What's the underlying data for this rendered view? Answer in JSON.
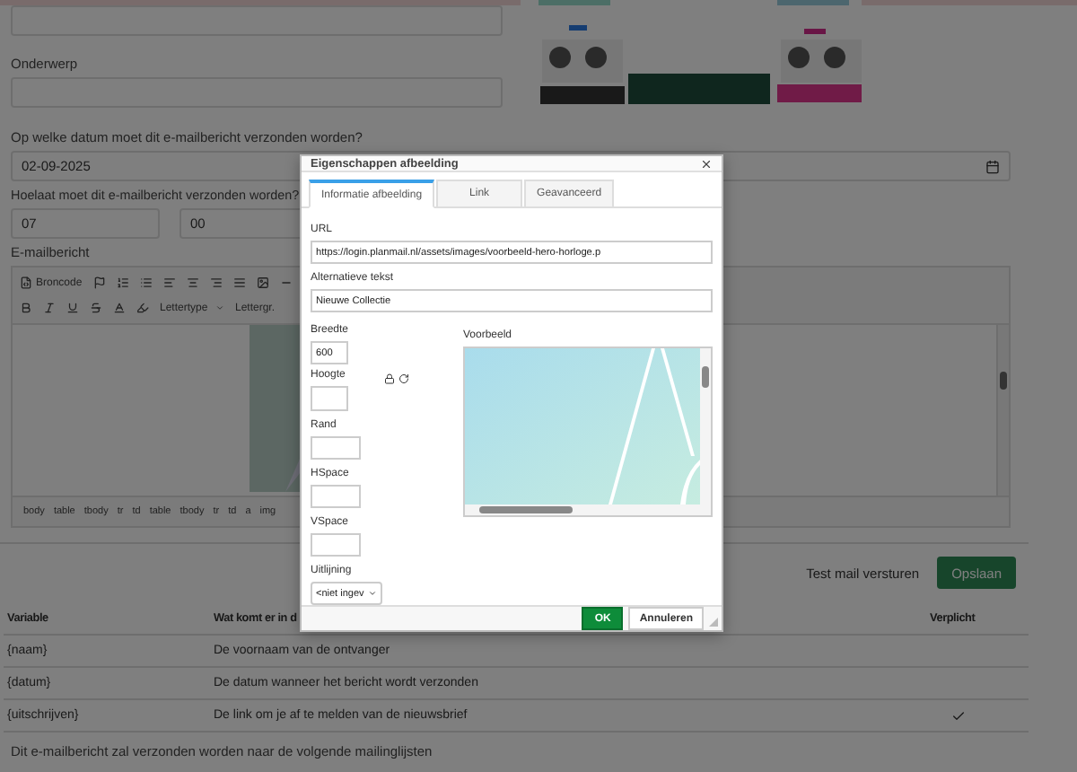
{
  "form": {
    "subject_label": "Onderwerp",
    "date_label": "Op welke datum moet dit e-mailbericht verzonden worden?",
    "date_value": "02-09-2025",
    "time_label": "Hoelaat moet dit e-mailbericht verzonden worden?",
    "hour": "07",
    "minute": "00",
    "message_label": "E-mailbericht"
  },
  "editor": {
    "source_button": "Broncode",
    "font_menu": "Lettertype",
    "size_menu": "Lettergr.",
    "path": [
      "body",
      "table",
      "tbody",
      "tr",
      "td",
      "table",
      "tbody",
      "tr",
      "td",
      "a",
      "img"
    ]
  },
  "actions": {
    "test_mail": "Test mail versturen",
    "save": "Opslaan"
  },
  "variables_table": {
    "columns": [
      "Variable",
      "Wat komt er in d",
      "Verplicht"
    ],
    "rows": [
      {
        "variable": "{naam}",
        "description": "De voornaam van de ontvanger",
        "required": false
      },
      {
        "variable": "{datum}",
        "description": "De datum wanneer het bericht wordt verzonden",
        "required": false
      },
      {
        "variable": "{uitschrijven}",
        "description": "De link om je af te melden van de nieuwsbrief",
        "required": true
      }
    ]
  },
  "footer_note": "Dit e-mailbericht zal verzonden worden naar de volgende mailinglijsten",
  "dialog": {
    "title": "Eigenschappen afbeelding",
    "tabs": [
      {
        "label": "Informatie afbeelding",
        "selected": true
      },
      {
        "label": "Link",
        "selected": false
      },
      {
        "label": "Geavanceerd",
        "selected": false
      }
    ],
    "url_label": "URL",
    "url": "https://login.planmail.nl/assets/images/voorbeeld-hero-horloge.p",
    "alt_label": "Alternatieve tekst",
    "alt": "Nieuwe Collectie",
    "fields": [
      {
        "label": "Breedte",
        "value": "600"
      },
      {
        "label": "Hoogte"
      },
      {
        "label": "Rand"
      },
      {
        "label": "HSpace"
      },
      {
        "label": "VSpace"
      }
    ],
    "align_label": "Uitlijning",
    "align_value": "<niet ingev",
    "preview_label": "Voorbeeld",
    "ok": "OK",
    "cancel": "Annuleren"
  }
}
